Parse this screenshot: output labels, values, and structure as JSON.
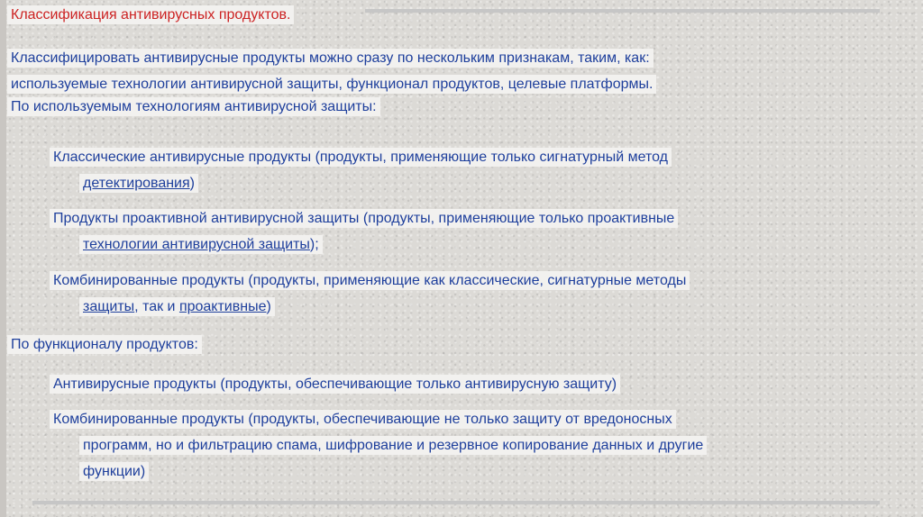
{
  "title": "Классификация антивирусных продуктов.",
  "intro": {
    "line1": "Классифицировать антивирусные продукты можно сразу по нескольким признакам, таким, как:",
    "line2": "используемые технологии антивирусной защиты, функционал продуктов, целевые платформы.",
    "line3": "По используемым технологиям антивирусной защиты:"
  },
  "tech": {
    "item1": {
      "line1": "Классические антивирусные продукты (продукты, применяющие только сигнатурный метод",
      "link": "детектирования",
      "tail": ")"
    },
    "item2": {
      "line1": "Продукты проактивной антивирусной защиты (продукты, применяющие только проактивные",
      "link": "технологии антивирусной защиты",
      "tail": ");"
    },
    "item3": {
      "line1": "Комбинированные продукты (продукты, применяющие как классические, сигнатурные методы",
      "link1": "защиты",
      "mid": ", так и ",
      "link2": "проактивные",
      "tail": ")"
    }
  },
  "func_heading": "По функционалу продуктов:",
  "func": {
    "item1": "Антивирусные продукты (продукты, обеспечивающие только антивирусную защиту)",
    "item2": {
      "line1": "Комбинированные продукты (продукты, обеспечивающие не только защиту от вредоносных",
      "line2": "программ, но и фильтрацию спама, шифрование и резервное копирование данных и другие",
      "line3": "функции)"
    }
  }
}
